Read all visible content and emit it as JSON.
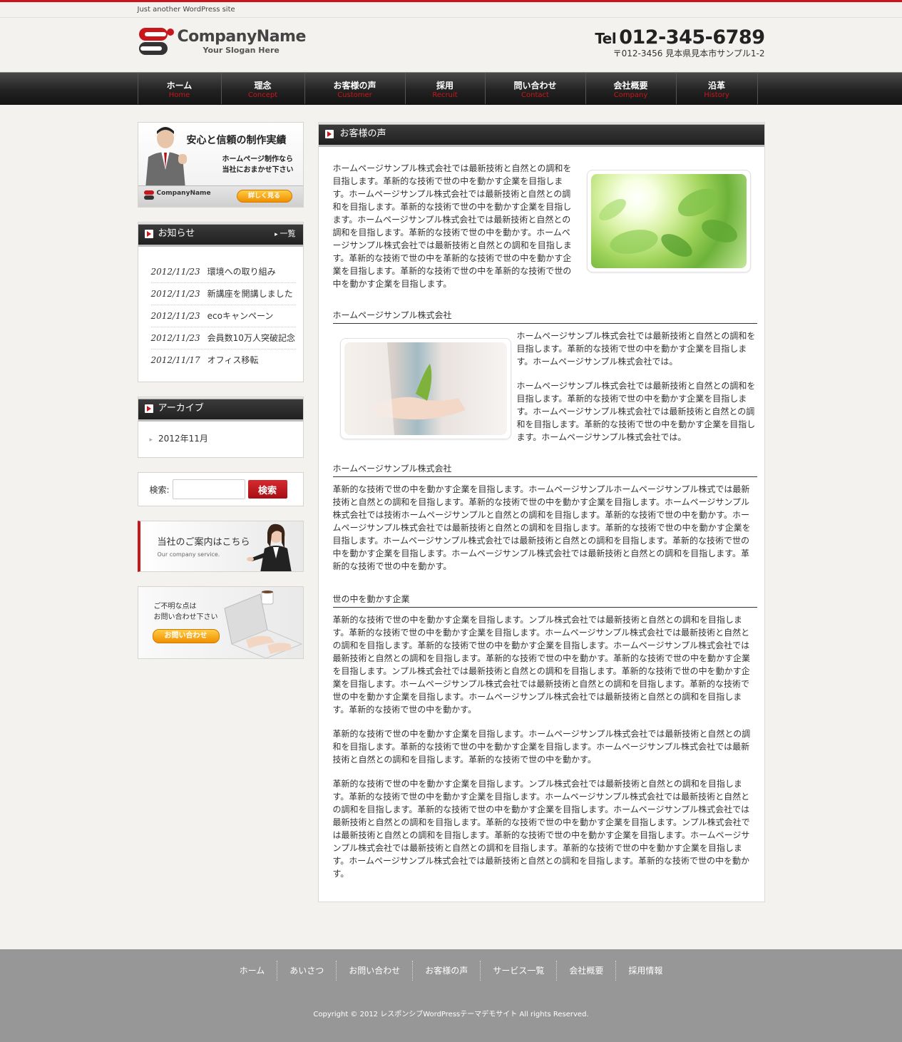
{
  "site": {
    "tagline": "Just another WordPress site",
    "company_name": "CompanyName",
    "slogan": "Your Slogan Here",
    "tel_label": "Tel",
    "tel_number": "012-345-6789",
    "address": "〒012-3456 見本県見本市サンプル1-2"
  },
  "colors": {
    "accent": "#c8161d",
    "nav_bg": "#222222",
    "footer_bg": "#979797",
    "button_orange": "#f4a010"
  },
  "nav": [
    {
      "ja": "ホーム",
      "en": "Home"
    },
    {
      "ja": "理念",
      "en": "Concept"
    },
    {
      "ja": "お客様の声",
      "en": "Customer"
    },
    {
      "ja": "採用",
      "en": "Recruit"
    },
    {
      "ja": "問い合わせ",
      "en": "Contact"
    },
    {
      "ja": "会社概要",
      "en": "Company"
    },
    {
      "ja": "沿革",
      "en": "History"
    }
  ],
  "sidebar": {
    "banner_top": {
      "headline": "安心と信頼の制作実績",
      "sub_line1": "ホームページ制作なら",
      "sub_line2": "当社におまかせ下さい",
      "mini_logo": "CompanyName",
      "button": "詳しく見る"
    },
    "news": {
      "title": "お知らせ",
      "more": "一覧",
      "items": [
        {
          "date": "2012/11/23",
          "text": "環境への取り組み"
        },
        {
          "date": "2012/11/23",
          "text": "新講座を開講しました"
        },
        {
          "date": "2012/11/23",
          "text": "ecoキャンペーン"
        },
        {
          "date": "2012/11/23",
          "text": "会員数10万人突破記念"
        },
        {
          "date": "2012/11/17",
          "text": "オフィス移転"
        }
      ]
    },
    "archive": {
      "title": "アーカイブ",
      "items": [
        "2012年11月"
      ]
    },
    "search": {
      "label": "検索:",
      "button": "検索",
      "placeholder": ""
    },
    "banner_company": {
      "text": "当社のご案内はこちら",
      "en": "Our company service."
    },
    "banner_contact": {
      "line1": "ご不明な点は",
      "line2": "お問い合わせ下さい",
      "button": "お問い合わせ"
    }
  },
  "content": {
    "title": "お客様の声",
    "intro": "ホームページサンプル株式会社では最新技術と自然との調和を目指します。革新的な技術で世の中を動かす企業を目指します。ホームページサンプル株式会社では最新技術と自然との調和を目指します。革新的な技術で世の中を動かす企業を目指します。ホームページサンプル株式会社では最新技術と自然との調和を目指します。革新的な技術で世の中を動かす。ホームページサンプル株式会社では最新技術と自然との調和を目指します。革新的な技術で世の中を革新的な技術で世の中を動かす企業を目指します。革新的な技術で世の中を革新的な技術で世の中を動かす企業を目指します。",
    "section1_title": "ホームページサンプル株式会社",
    "section1_p1": "ホームページサンプル株式会社では最新技術と自然との調和を目指します。革新的な技術で世の中を動かす企業を目指します。ホームページサンプル株式会社では。",
    "section1_p2": "ホームページサンプル株式会社では最新技術と自然との調和を目指します。革新的な技術で世の中を動かす企業を目指します。ホームページサンプル株式会社では最新技術と自然との調和を目指します。革新的な技術で世の中を動かす企業を目指します。ホームページサンプル株式会社では。",
    "section2_title": "ホームページサンプル株式会社",
    "section2_p1": "革新的な技術で世の中を動かす企業を目指します。ホームページサンプルホームページサンプル株式では最新技術と自然との調和を目指します。革新的な技術で世の中を動かす企業を目指します。ホームページサンプル株式会社では技術ホームページサンプルと自然との調和を目指します。革新的な技術で世の中を動かす。ホームページサンプル株式会社では最新技術と自然との調和を目指します。革新的な技術で世の中を動かす企業を目指します。ホームページサンプル株式会社では最新技術と自然との調和を目指します。革新的な技術で世の中を動かす企業を目指します。ホームページサンプル株式会社では最新技術と自然との調和を目指します。革新的な技術で世の中を動かす。",
    "section3_title": "世の中を動かす企業",
    "section3_p1": "革新的な技術で世の中を動かす企業を目指します。ンプル株式会社では最新技術と自然との調和を目指します。革新的な技術で世の中を動かす企業を目指します。ホームページサンプル株式会社では最新技術と自然との調和を目指します。革新的な技術で世の中を動かす企業を目指します。ホームページサンプル株式会社では最新技術と自然との調和を目指します。革新的な技術で世の中を動かす。革新的な技術で世の中を動かす企業を目指します。ンプル株式会社では最新技術と自然との調和を目指します。革新的な技術で世の中を動かす企業を目指します。ホームページサンプル株式会社では最新技術と自然との調和を目指します。革新的な技術で世の中を動かす企業を目指します。ホームページサンプル株式会社では最新技術と自然との調和を目指します。革新的な技術で世の中を動かす。",
    "section3_p2": "革新的な技術で世の中を動かす企業を目指します。ホームページサンプル株式会社では最新技術と自然との調和を目指します。革新的な技術で世の中を動かす企業を目指します。ホームページサンプル株式会社では最新技術と自然との調和を目指します。革新的な技術で世の中を動かす。",
    "section3_p3": "革新的な技術で世の中を動かす企業を目指します。ンプル株式会社では最新技術と自然との調和を目指します。革新的な技術で世の中を動かす企業を目指します。ホームページサンプル株式会社では最新技術と自然との調和を目指します。革新的な技術で世の中を動かす企業を目指します。ホームページサンプル株式会社では最新技術と自然との調和を目指します。革新的な技術で世の中を動かす企業を目指します。ンプル株式会社では最新技術と自然との調和を目指します。革新的な技術で世の中を動かす企業を目指します。ホームページサンプル株式会社では最新技術と自然との調和を目指します。革新的な技術で世の中を動かす企業を目指します。ホームページサンプル株式会社では最新技術と自然との調和を目指します。革新的な技術で世の中を動かす。"
  },
  "footer": {
    "nav": [
      "ホーム",
      "あいさつ",
      "お問い合わせ",
      "お客様の声",
      "サービス一覧",
      "会社概要",
      "採用情報"
    ],
    "copyright": "Copyright © 2012 レスポンシブWordPressテーマデモサイト All rights Reserved."
  }
}
